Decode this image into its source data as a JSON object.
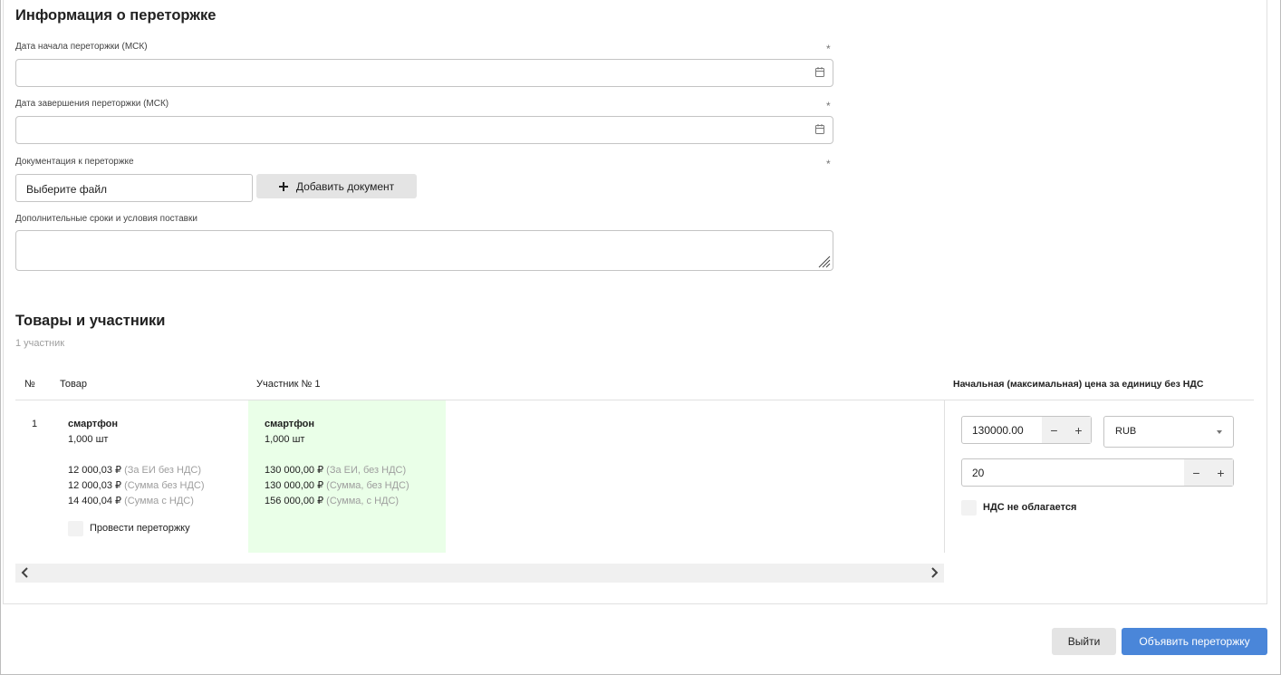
{
  "info": {
    "title": "Информация о переторжке",
    "start_date_label": "Дата начала переторжки (МСК)",
    "end_date_label": "Дата завершения переторжки (МСК)",
    "docs_label": "Документация к переторжке",
    "required_mark": "*",
    "file_placeholder": "Выберите файл",
    "add_doc_label": "Добавить документ",
    "extra_terms_label": "Дополнительные сроки и условия поставки"
  },
  "goods": {
    "title": "Товары и участники",
    "participants_count": "1 участник",
    "columns": {
      "num": "№",
      "product": "Товар",
      "participant": "Участник № 1",
      "max_price": "Начальная (максимальная) цена за единицу без НДС"
    },
    "row": {
      "num": "1",
      "product": {
        "name": "смартфон",
        "qty": "1,000 шт",
        "lines": [
          {
            "amount": "12 000,03 ₽",
            "note": "(За ЕИ без НДС)"
          },
          {
            "amount": "12 000,03 ₽",
            "note": "(Сумма без НДС)"
          },
          {
            "amount": "14 400,04 ₽",
            "note": "(Сумма с НДС)"
          }
        ],
        "checkbox_label": "Провести переторжку"
      },
      "participant": {
        "name": "смартфон",
        "qty": "1,000 шт",
        "lines": [
          {
            "amount": "130 000,00 ₽",
            "note": "(За ЕИ, без НДС)"
          },
          {
            "amount": "130 000,00 ₽",
            "note": "(Сумма, без НДС)"
          },
          {
            "amount": "156 000,00 ₽",
            "note": "(Сумма, с НДС)"
          }
        ]
      },
      "price": {
        "value": "130000.00",
        "currency": "RUB",
        "vat": "20",
        "minus": "−",
        "plus": "+",
        "no_vat_label": "НДС не облагается"
      }
    }
  },
  "footer": {
    "exit_label": "Выйти",
    "submit_label": "Объявить переторжку"
  },
  "colors": {
    "accent": "#4a86d9",
    "participant_highlight": "#eaffe8"
  }
}
